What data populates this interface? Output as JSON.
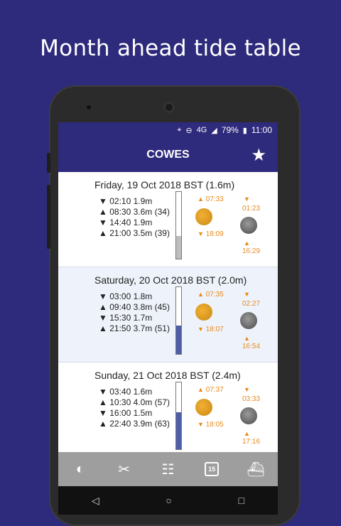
{
  "headline": "Month ahead tide table",
  "status": {
    "network": "4G",
    "battery": "79%",
    "time": "11:00"
  },
  "header": {
    "title": "COWES"
  },
  "days": [
    {
      "date": "Friday, 19 Oct 2018 BST (1.6m)",
      "tides": [
        {
          "dir": "▼",
          "text": "02:10 1.9m"
        },
        {
          "dir": "▲",
          "text": "08:30 3.6m (34)"
        },
        {
          "dir": "▼",
          "text": "14:40 1.9m"
        },
        {
          "dir": "▲",
          "text": "21:00 3.5m (39)"
        }
      ],
      "level": 0.34,
      "sunrise": "07:33",
      "sunset": "18:09",
      "moonset": "01:23",
      "moonrise": "16:29"
    },
    {
      "date": "Saturday, 20 Oct 2018 BST (2.0m)",
      "tides": [
        {
          "dir": "▼",
          "text": "03:00 1.8m"
        },
        {
          "dir": "▲",
          "text": "09:40 3.8m (45)"
        },
        {
          "dir": "▼",
          "text": "15:30 1.7m"
        },
        {
          "dir": "▲",
          "text": "21:50 3.7m (51)"
        }
      ],
      "level": 0.43,
      "sunrise": "07:35",
      "sunset": "18:07",
      "moonset": "02:27",
      "moonrise": "16:54"
    },
    {
      "date": "Sunday, 21 Oct 2018 BST (2.4m)",
      "tides": [
        {
          "dir": "▼",
          "text": "03:40 1.6m"
        },
        {
          "dir": "▲",
          "text": "10:30 4.0m (57)"
        },
        {
          "dir": "▼",
          "text": "16:00 1.5m"
        },
        {
          "dir": "▲",
          "text": "22:40 3.9m (63)"
        }
      ],
      "level": 0.55,
      "sunrise": "07:37",
      "sunset": "18:05",
      "moonset": "03:33",
      "moonrise": "17:16"
    }
  ],
  "nav": {
    "calendar_day": "15"
  },
  "colors": {
    "primary": "#2e2a7c",
    "accent": "#e8891a",
    "fill": "#4f5ea8"
  }
}
